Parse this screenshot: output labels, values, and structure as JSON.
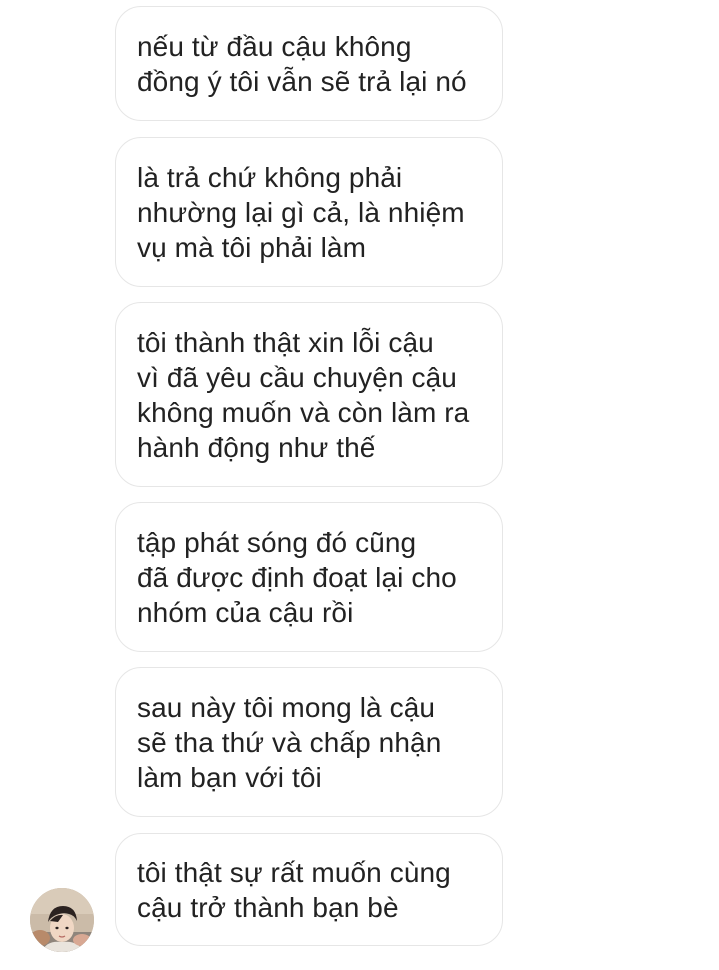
{
  "conversation": {
    "messages": [
      {
        "text": "nếu từ đầu cậu không\nđồng ý tôi vẫn sẽ trả lại nó"
      },
      {
        "text": "là trả chứ không phải\nnhường lại gì cả, là nhiệm\nvụ mà tôi phải làm"
      },
      {
        "text": "tôi thành thật xin lỗi cậu\nvì đã yêu cầu chuyện cậu\nkhông muốn và còn làm ra\nhành động như thế"
      },
      {
        "text": "tập phát sóng đó cũng\nđã được định đoạt lại cho\nnhóm của cậu rồi"
      },
      {
        "text": "sau này tôi mong là cậu\nsẽ tha thứ và chấp nhận\nlàm bạn với tôi"
      },
      {
        "text": "tôi thật sự rất muốn cùng\ncậu trở thành bạn bè"
      }
    ],
    "sender_avatar": {
      "icon": "profile-photo",
      "bg_color": "#c9b9a7"
    }
  }
}
